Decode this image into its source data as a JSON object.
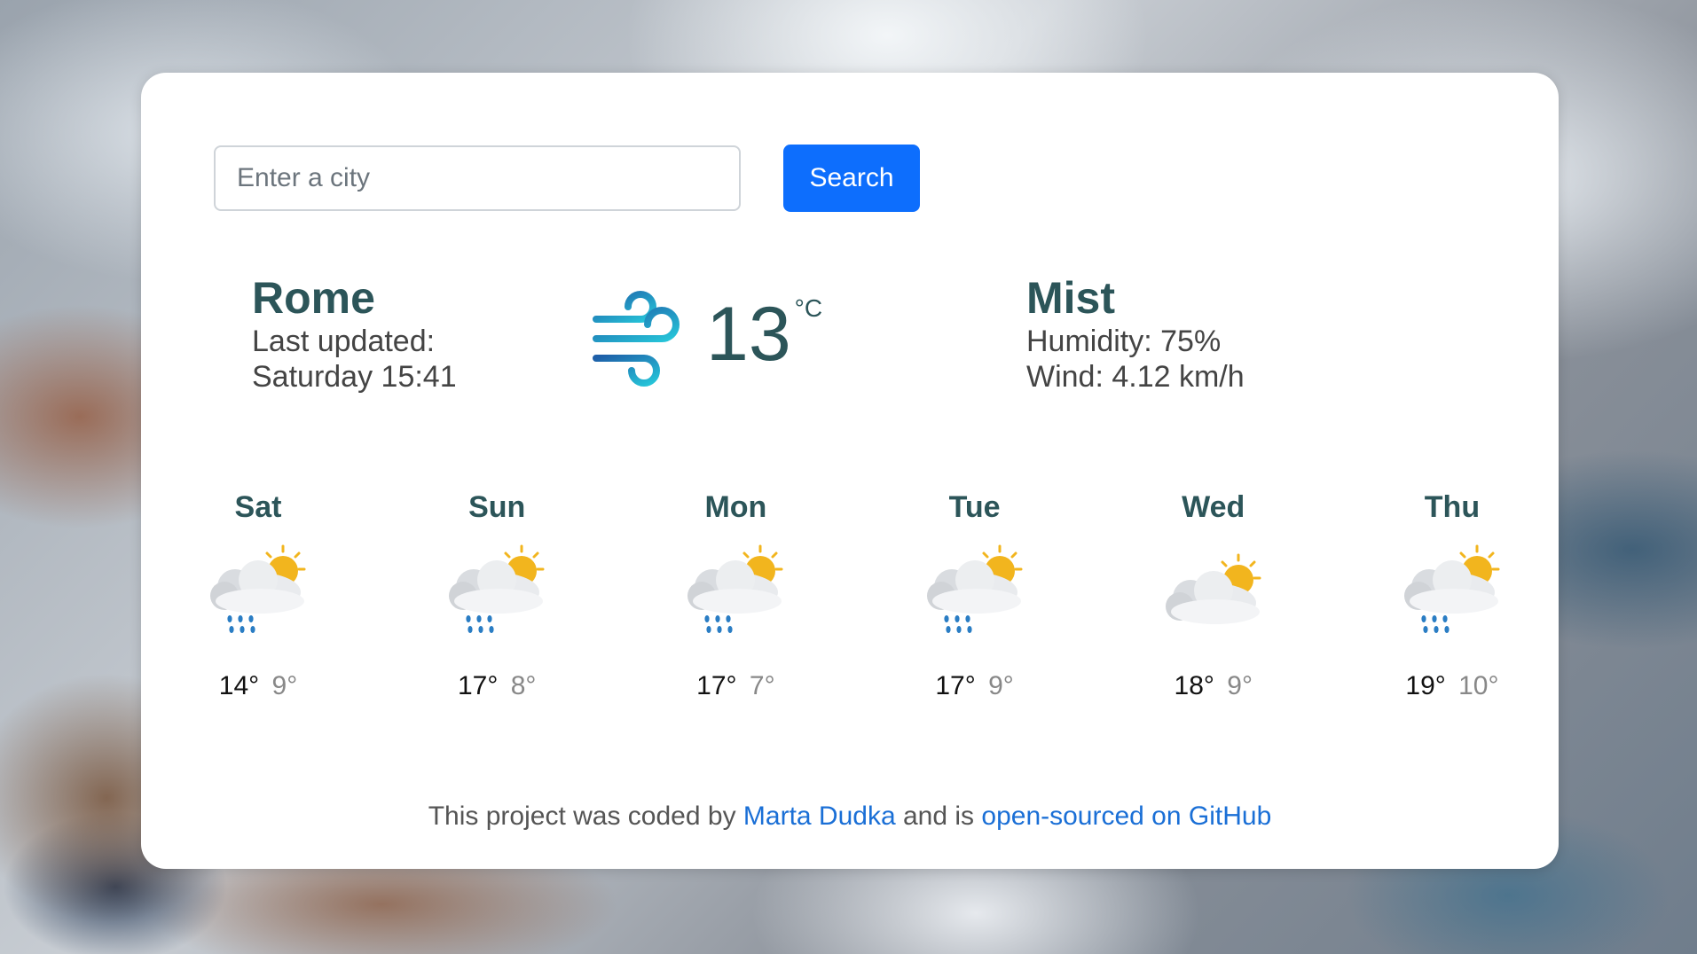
{
  "search": {
    "placeholder": "Enter a city",
    "button_label": "Search"
  },
  "current": {
    "city": "Rome",
    "updated_label": "Last updated:",
    "updated_time": "Saturday 15:41",
    "icon": "wind-icon",
    "temperature": "13",
    "unit": "°C",
    "condition": "Mist",
    "humidity": "Humidity: 75%",
    "wind": "Wind: 4.12 km/h"
  },
  "forecast": [
    {
      "day": "Sat",
      "icon": "rain-cloud-sun-icon",
      "max": "14°",
      "min": "9°"
    },
    {
      "day": "Sun",
      "icon": "rain-cloud-sun-icon",
      "max": "17°",
      "min": "8°"
    },
    {
      "day": "Mon",
      "icon": "rain-cloud-sun-icon",
      "max": "17°",
      "min": "7°"
    },
    {
      "day": "Tue",
      "icon": "rain-cloud-sun-icon",
      "max": "17°",
      "min": "9°"
    },
    {
      "day": "Wed",
      "icon": "partly-cloudy-icon",
      "max": "18°",
      "min": "9°"
    },
    {
      "day": "Thu",
      "icon": "rain-cloud-sun-icon",
      "max": "19°",
      "min": "10°"
    }
  ],
  "footer": {
    "prefix": "This project was coded by ",
    "author_link": "Marta Dudka",
    "middle": " and is ",
    "repo_link": "open-sourced on GitHub"
  },
  "colors": {
    "accent": "#0d6efd",
    "heading": "#2c5559",
    "link": "#1a6fd6"
  }
}
